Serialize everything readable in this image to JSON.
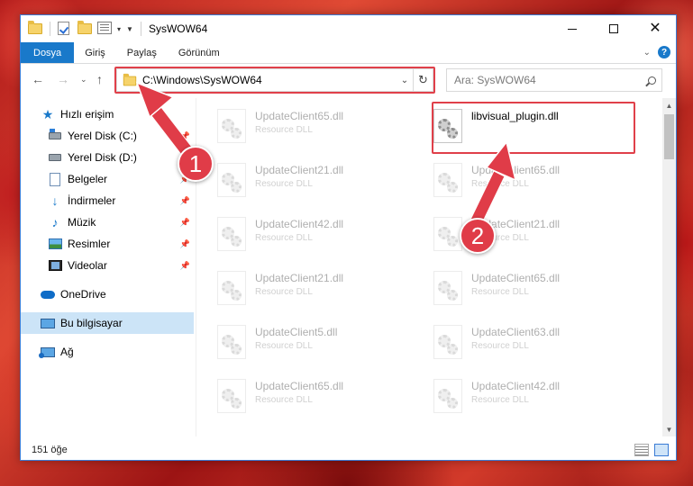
{
  "window": {
    "title": "SysWOW64"
  },
  "ribbon": {
    "tabs": [
      "Dosya",
      "Giriş",
      "Paylaş",
      "Görünüm"
    ],
    "active_tab": "Dosya"
  },
  "navigation": {
    "address_path": "C:\\Windows\\SysWOW64",
    "search_placeholder": "Ara: SysWOW64"
  },
  "sidebar": {
    "items": [
      {
        "label": "Hızlı erişim",
        "icon": "star-icon",
        "pinned": false
      },
      {
        "label": "Yerel Disk (C:)",
        "icon": "windows-drive-icon",
        "pinned": true
      },
      {
        "label": "Yerel Disk (D:)",
        "icon": "drive-icon",
        "pinned": true
      },
      {
        "label": "Belgeler",
        "icon": "documents-icon",
        "pinned": true
      },
      {
        "label": "İndirmeler",
        "icon": "downloads-icon",
        "pinned": true
      },
      {
        "label": "Müzik",
        "icon": "music-icon",
        "pinned": true
      },
      {
        "label": "Resimler",
        "icon": "pictures-icon",
        "pinned": true
      },
      {
        "label": "Videolar",
        "icon": "videos-icon",
        "pinned": true
      },
      {
        "label": "OneDrive",
        "icon": "onedrive-icon",
        "pinned": false
      },
      {
        "label": "Bu bilgisayar",
        "icon": "this-pc-icon",
        "pinned": false,
        "selected": true
      },
      {
        "label": "Ağ",
        "icon": "network-icon",
        "pinned": false
      }
    ]
  },
  "files": [
    {
      "name": "UpdateClient65.dll",
      "type": "Resource DLL",
      "faded": true
    },
    {
      "name": "libvisual_plugin.dll",
      "type": "",
      "faded": false
    },
    {
      "name": "UpdateClient21.dll",
      "type": "Resource DLL",
      "faded": true
    },
    {
      "name": "UpdateClient65.dll",
      "type": "Resource DLL",
      "faded": true
    },
    {
      "name": "UpdateClient42.dll",
      "type": "Resource DLL",
      "faded": true
    },
    {
      "name": "UpdateClient21.dll",
      "type": "Resource DLL",
      "faded": true
    },
    {
      "name": "UpdateClient21.dll",
      "type": "Resource DLL",
      "faded": true
    },
    {
      "name": "UpdateClient65.dll",
      "type": "Resource DLL",
      "faded": true
    },
    {
      "name": "UpdateClient5.dll",
      "type": "Resource DLL",
      "faded": true
    },
    {
      "name": "UpdateClient63.dll",
      "type": "Resource DLL",
      "faded": true
    },
    {
      "name": "UpdateClient65.dll",
      "type": "Resource DLL",
      "faded": true
    },
    {
      "name": "UpdateClient42.dll",
      "type": "Resource DLL",
      "faded": true
    }
  ],
  "status": {
    "item_count": "151 öğe"
  },
  "annotations": {
    "marker_1": "1",
    "marker_2": "2",
    "color": "#e03c48"
  }
}
